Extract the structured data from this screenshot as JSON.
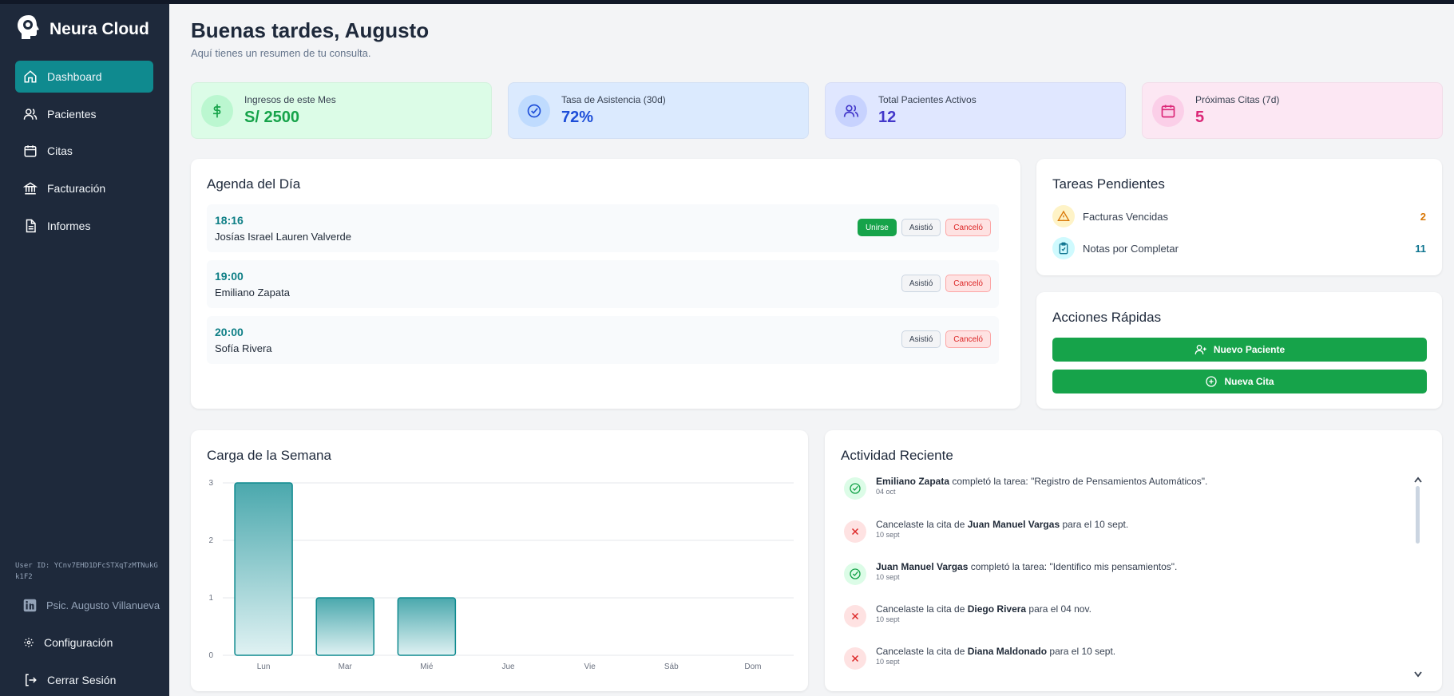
{
  "brand": {
    "name": "Neura Cloud"
  },
  "nav": [
    {
      "label": "Dashboard",
      "icon": "home-icon",
      "active": true
    },
    {
      "label": "Pacientes",
      "icon": "users-icon"
    },
    {
      "label": "Citas",
      "icon": "calendar-icon"
    },
    {
      "label": "Facturación",
      "icon": "bank-icon"
    },
    {
      "label": "Informes",
      "icon": "document-icon"
    }
  ],
  "sidebar_footer": {
    "user_id": "User ID: YCnv7EHD1DFcSTXqTzMTNukGk1F2",
    "profile": "Psic. Augusto Villanueva",
    "settings": "Configuración",
    "logout": "Cerrar Sesión"
  },
  "header": {
    "greeting": "Buenas tardes, Augusto",
    "subtitle": "Aquí tienes un resumen de tu consulta."
  },
  "stats": [
    {
      "label": "Ingresos de este Mes",
      "value": "S/ 2500",
      "icon": "dollar-icon",
      "color": "#16a34a",
      "bg": "#dcfce7",
      "circle": "#bbf7d0"
    },
    {
      "label": "Tasa de Asistencia (30d)",
      "value": "72%",
      "icon": "check-circle-icon",
      "color": "#1d4ed8",
      "bg": "#dbeafe",
      "circle": "#bfdbfe"
    },
    {
      "label": "Total Pacientes Activos",
      "value": "12",
      "icon": "users-icon",
      "color": "#4338ca",
      "bg": "#e0e7ff",
      "circle": "#c7d2fe"
    },
    {
      "label": "Próximas Citas (7d)",
      "value": "5",
      "icon": "calendar-icon",
      "color": "#db2777",
      "bg": "#fce7f3",
      "circle": "#fbcfe8"
    }
  ],
  "agenda": {
    "title": "Agenda del Día",
    "join_label": "Unirse",
    "attended_label": "Asistió",
    "cancelled_label": "Canceló",
    "items": [
      {
        "time": "18:16",
        "name": "Josías Israel Lauren Valverde",
        "joinable": true
      },
      {
        "time": "19:00",
        "name": "Emiliano Zapata",
        "joinable": false
      },
      {
        "time": "20:00",
        "name": "Sofía Rivera",
        "joinable": false
      }
    ]
  },
  "tasks": {
    "title": "Tareas Pendientes",
    "items": [
      {
        "label": "Facturas Vencidas",
        "count": "2",
        "icon": "warning-icon",
        "color": "#d97706",
        "bg": "#fef3c7"
      },
      {
        "label": "Notas por Completar",
        "count": "11",
        "icon": "clipboard-icon",
        "color": "#0e7490",
        "bg": "#cffafe"
      }
    ]
  },
  "quick_actions": {
    "title": "Acciones Rápidas",
    "new_patient": "Nuevo Paciente",
    "new_appointment": "Nueva Cita"
  },
  "week_load": {
    "title": "Carga de la Semana"
  },
  "chart_data": {
    "type": "bar",
    "categories": [
      "Lun",
      "Mar",
      "Mié",
      "Jue",
      "Vie",
      "Sáb",
      "Dom"
    ],
    "values": [
      3,
      1,
      1,
      0,
      0,
      0,
      0
    ],
    "yticks": [
      "0",
      "1",
      "2",
      "3"
    ],
    "ylim": [
      0,
      3
    ],
    "grid": true,
    "bar_color": "#0f8a8f"
  },
  "activity": {
    "title": "Actividad Reciente",
    "items": [
      {
        "kind": "done",
        "who": "Emiliano Zapata",
        "text": " completó la tarea: \"Registro de Pensamientos Automáticos\".",
        "date": "04 oct"
      },
      {
        "kind": "cancel",
        "pre": "Cancelaste la cita de ",
        "who": "Juan Manuel Vargas",
        "text": " para el 10 sept.",
        "date": "10 sept"
      },
      {
        "kind": "done",
        "who": "Juan Manuel Vargas",
        "text": " completó la tarea: \"Identifico mis pensamientos\".",
        "date": "10 sept"
      },
      {
        "kind": "cancel",
        "pre": "Cancelaste la cita de ",
        "who": "Diego Rivera",
        "text": " para el 04 nov.",
        "date": "10 sept"
      },
      {
        "kind": "cancel",
        "pre": "Cancelaste la cita de ",
        "who": "Diana Maldonado",
        "text": " para el 10 sept.",
        "date": "10 sept"
      }
    ]
  }
}
